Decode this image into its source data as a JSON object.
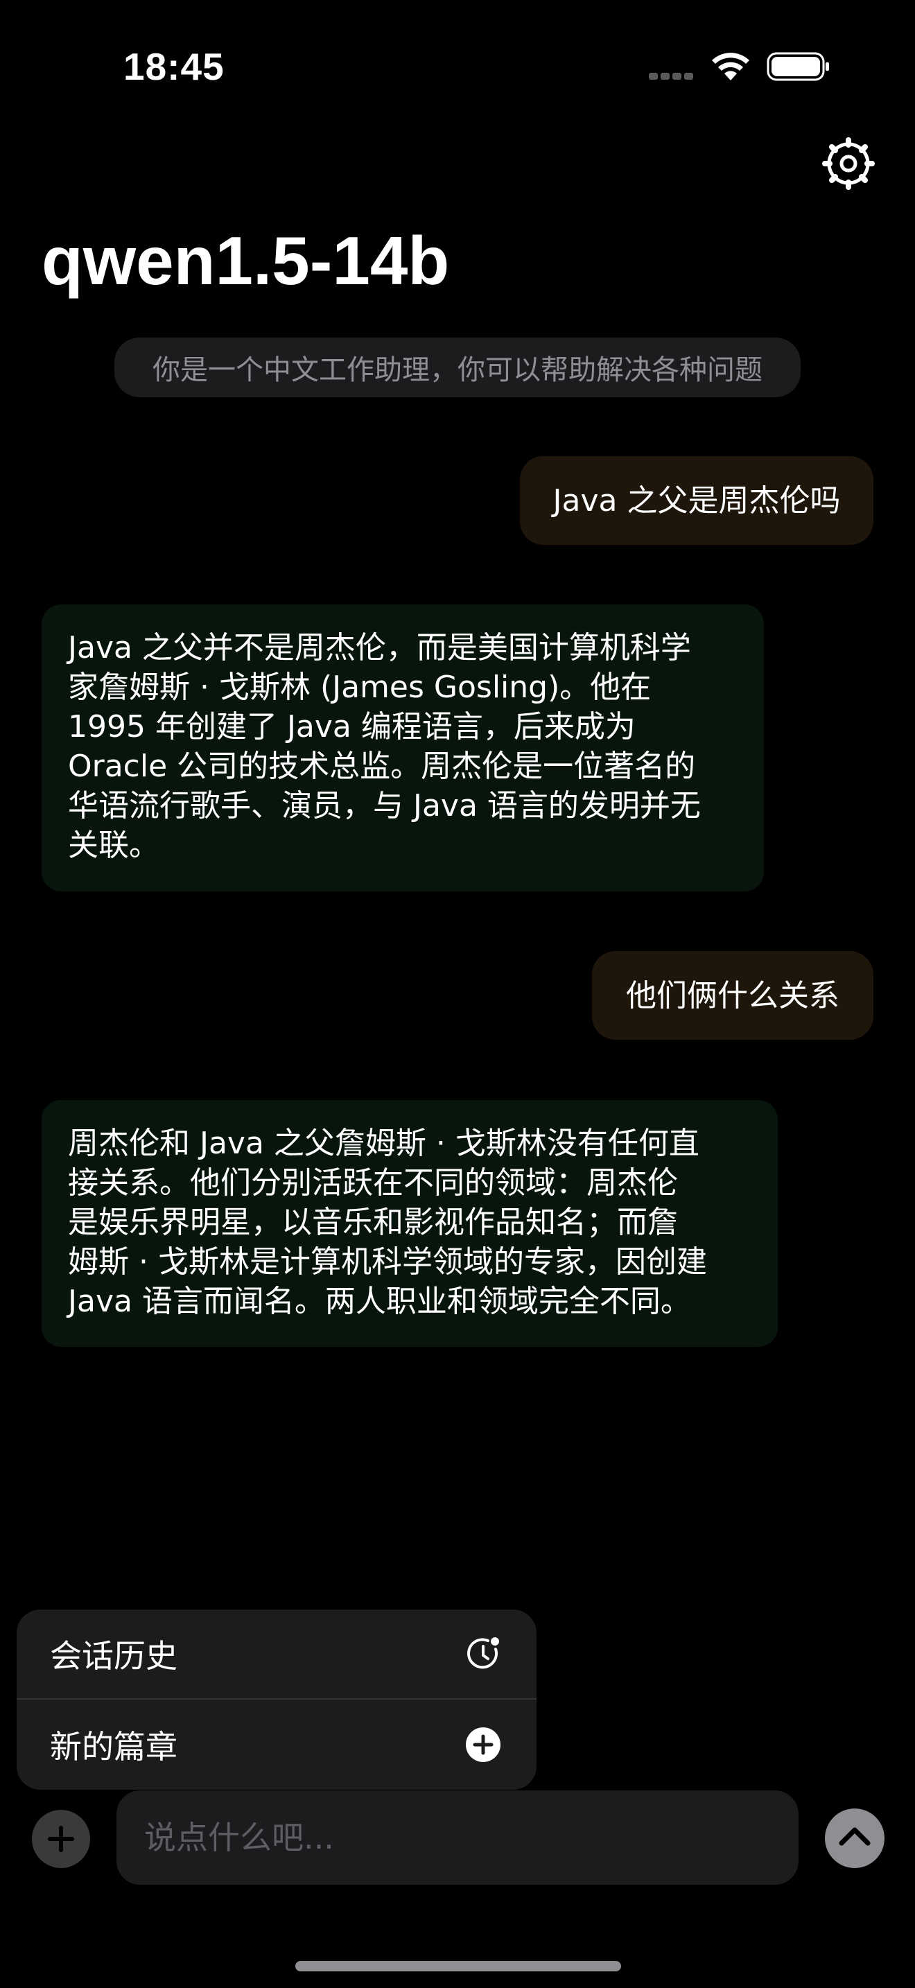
{
  "status_bar": {
    "time": "18:45"
  },
  "header": {
    "title": "qwen1.5-14b",
    "settings_icon": "gear-icon"
  },
  "system_prompt": "你是一个中文工作助理，你可以帮助解决各种问题",
  "messages": [
    {
      "role": "user",
      "lines": [
        "Java 之父是周杰伦吗"
      ]
    },
    {
      "role": "assistant",
      "lines": [
        "Java 之父并不是周杰伦，而是美国计算机科学",
        "家詹姆斯 · 戈斯林 (James Gosling)。他在",
        "1995 年创建了 Java 编程语言，后来成为",
        "Oracle 公司的技术总监。周杰伦是一位著名的",
        "华语流行歌手、演员，与 Java 语言的发明并无",
        "关联。"
      ]
    },
    {
      "role": "user",
      "lines": [
        "他们俩什么关系"
      ]
    },
    {
      "role": "assistant",
      "lines": [
        "周杰伦和 Java 之父詹姆斯 · 戈斯林没有任何直",
        "接关系。他们分别活跃在不同的领域：周杰伦",
        "是娱乐界明星，以音乐和影视作品知名；而詹",
        "姆斯 · 戈斯林是计算机科学领域的专家，因创建",
        "Java 语言而闻名。两人职业和领域完全不同。"
      ]
    }
  ],
  "menu": {
    "items": [
      {
        "label": "会话历史",
        "icon": "history-clock-icon"
      },
      {
        "label": "新的篇章",
        "icon": "plus-circle-icon"
      }
    ]
  },
  "composer": {
    "placeholder": "说点什么吧...",
    "value": ""
  }
}
